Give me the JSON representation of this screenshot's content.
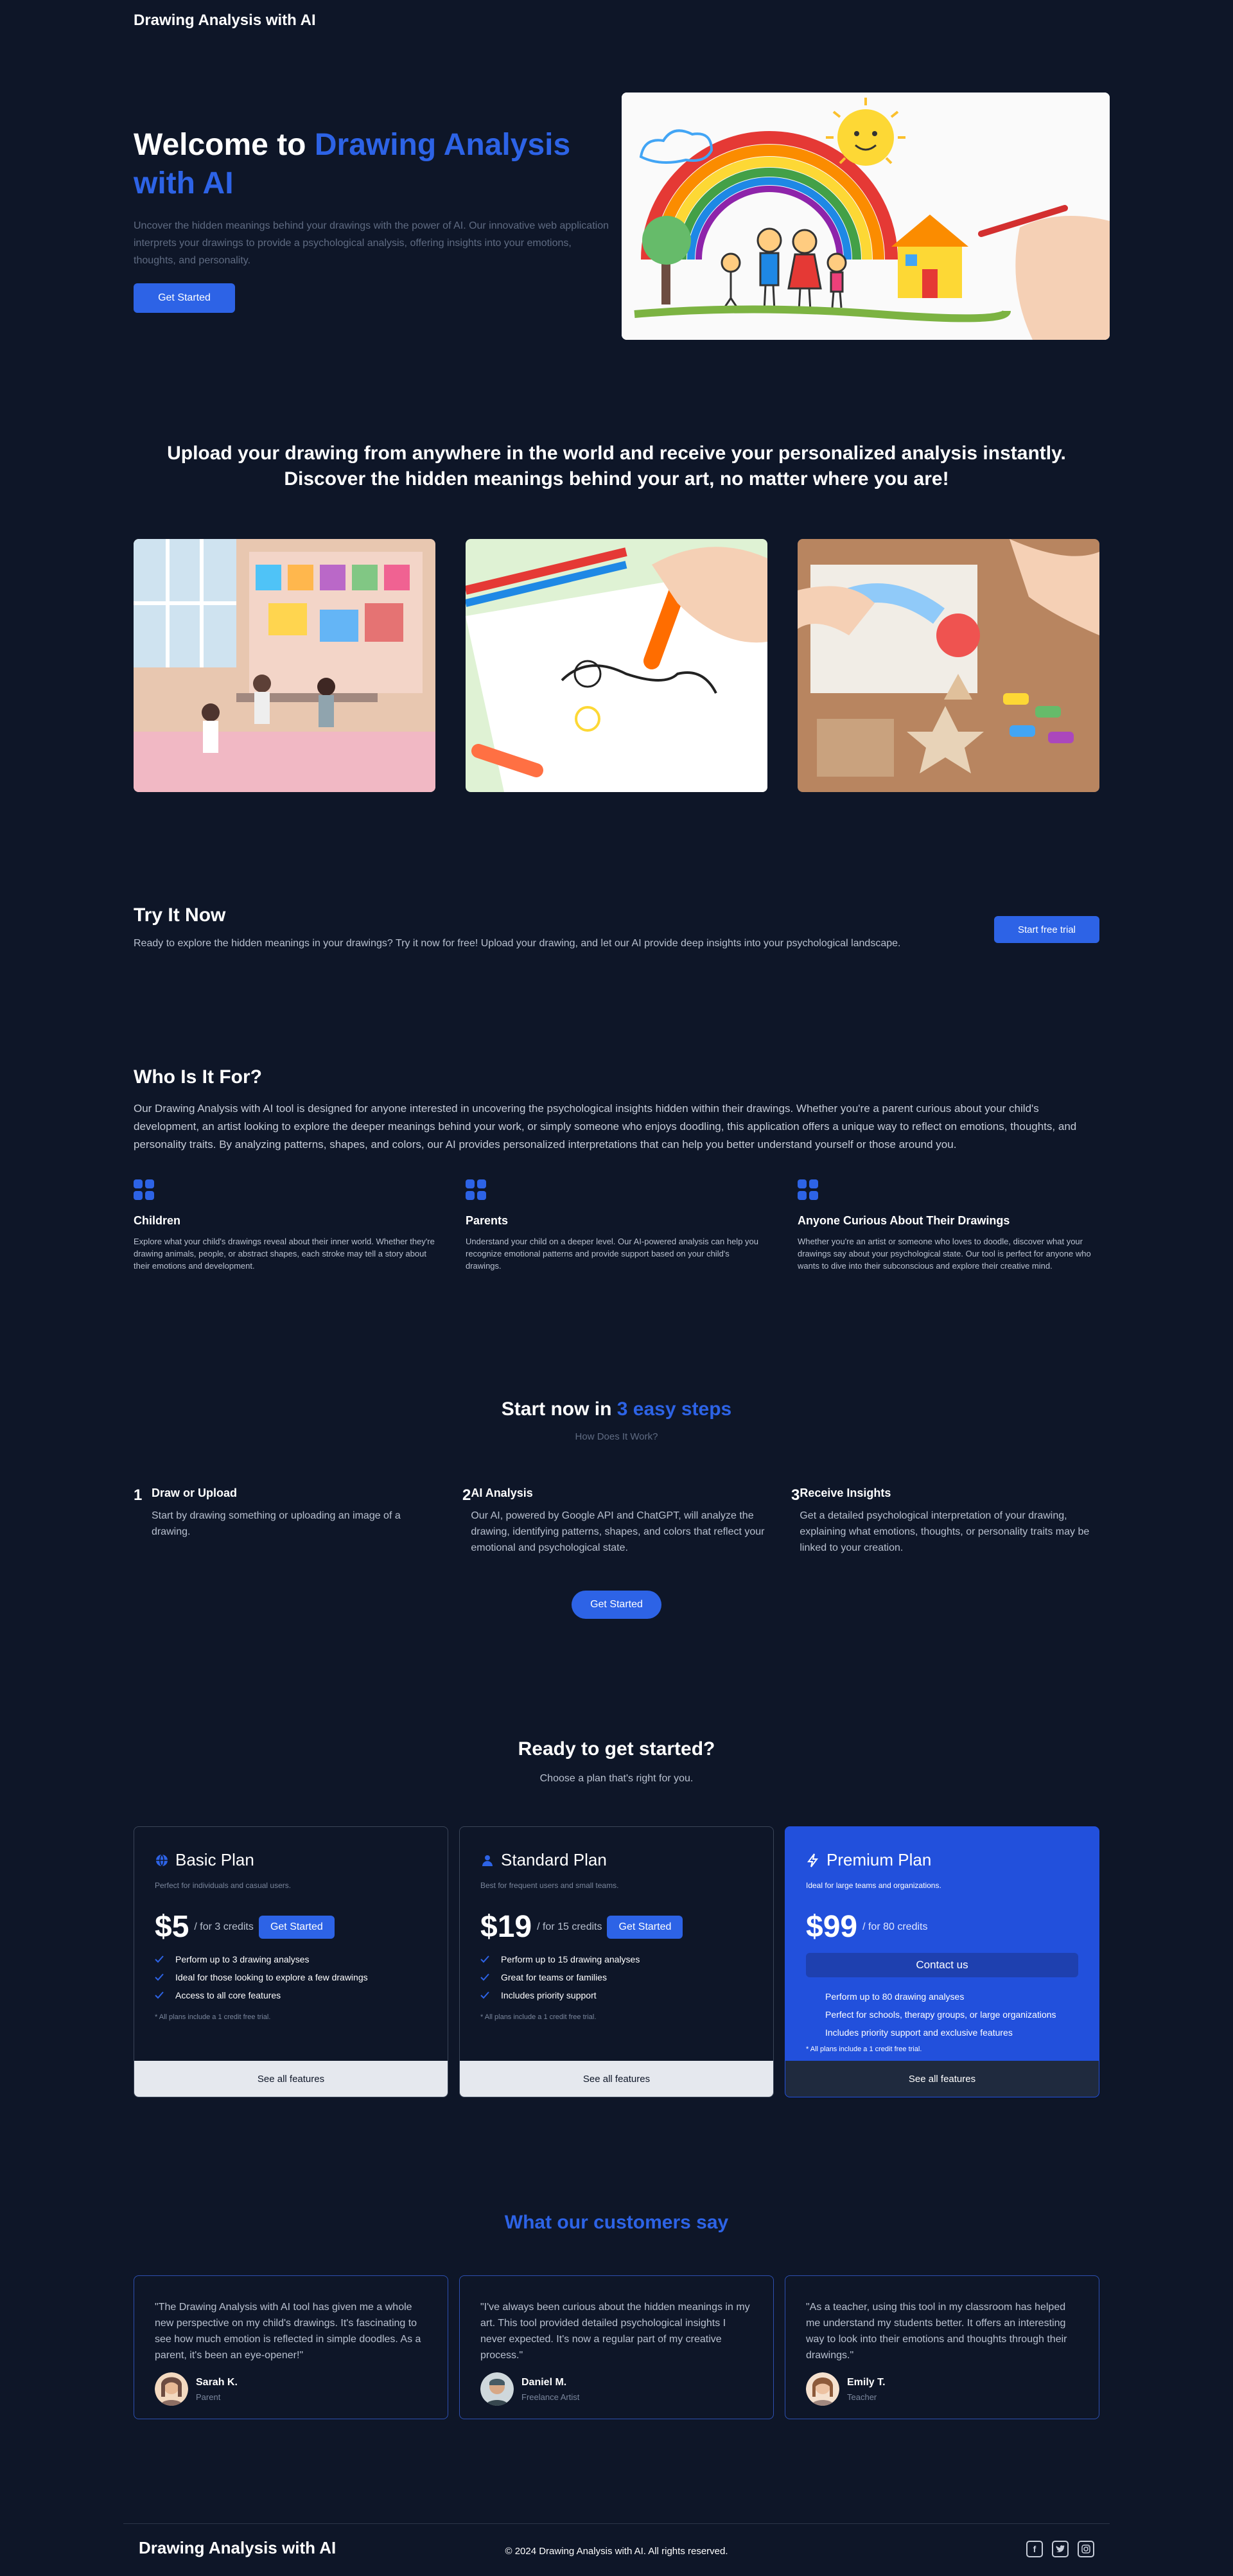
{
  "header": {
    "brand": "Drawing Analysis with AI"
  },
  "hero": {
    "title_prefix": "Welcome to ",
    "title_highlight": "Drawing Analysis with AI",
    "description": "Uncover the hidden meanings behind your drawings with the power of AI. Our innovative web application interprets your drawings to provide a psychological analysis, offering insights into your emotions, thoughts, and personality.",
    "cta_label": "Get Started",
    "image": "child-drawing-rainbow-family-house"
  },
  "upload": {
    "title": "Upload your drawing from anywhere in the world and receive your personalized analysis instantly. Discover the hidden meanings behind your art, no matter where you are!",
    "images": [
      "classroom-children-drawing",
      "child-coloring-marker",
      "hands-crafting-with-crayons"
    ]
  },
  "try_now": {
    "title": "Try It Now",
    "text": "Ready to explore the hidden meanings in your drawings? Try it now for free! Upload your drawing, and let our AI provide deep insights into your psychological landscape.",
    "button": "Start free trial"
  },
  "who": {
    "title": "Who Is It For?",
    "lead": "Our Drawing Analysis with AI tool is designed for anyone interested in uncovering the psychological insights hidden within their drawings. Whether you're a parent curious about your child's development, an artist looking to explore the deeper meanings behind your work, or simply someone who enjoys doodling, this application offers a unique way to reflect on emotions, thoughts, and personality traits. By analyzing patterns, shapes, and colors, our AI provides personalized interpretations that can help you better understand yourself or those around you.",
    "audiences": [
      {
        "title": "Children",
        "text": "Explore what your child's drawings reveal about their inner world. Whether they're drawing animals, people, or abstract shapes, each stroke may tell a story about their emotions and development."
      },
      {
        "title": "Parents",
        "text": "Understand your child on a deeper level. Our AI-powered analysis can help you recognize emotional patterns and provide support based on your child's drawings."
      },
      {
        "title": "Anyone Curious About Their Drawings",
        "text": "Whether you're an artist or someone who loves to doodle, discover what your drawings say about your psychological state. Our tool is perfect for anyone who wants to dive into their subconscious and explore their creative mind."
      }
    ]
  },
  "steps": {
    "title_prefix": "Start now in ",
    "title_highlight": "3 easy steps",
    "subtitle": "How Does It Work?",
    "items": [
      {
        "num": "1",
        "title": "Draw or Upload",
        "text": "Start by drawing something or uploading an image of a drawing."
      },
      {
        "num": "2",
        "title": "AI Analysis",
        "text": "Our AI, powered by Google API and ChatGPT, will analyze the drawing, identifying patterns, shapes, and colors that reflect your emotional and psychological state."
      },
      {
        "num": "3",
        "title": "Receive Insights",
        "text": "Get a detailed psychological interpretation of your drawing, explaining what emotions, thoughts, or personality traits may be linked to your creation."
      }
    ],
    "button": "Get Started"
  },
  "pricing": {
    "title": "Ready to get started?",
    "subtitle": "Choose a plan that's right for you.",
    "plans": [
      {
        "name": "Basic Plan",
        "icon": "globe-icon",
        "desc": "Perfect for individuals and casual users.",
        "price": "$5",
        "credits": "/ for 3 credits",
        "button": "Get Started",
        "features": [
          "Perform up to 3 drawing analyses",
          "Ideal for those looking to explore a few drawings",
          "Access to all core features"
        ],
        "note": "* All plans include a 1 credit free trial.",
        "footer": "See all features"
      },
      {
        "name": "Standard Plan",
        "icon": "user-icon",
        "desc": "Best for frequent users and small teams.",
        "price": "$19",
        "credits": "/ for 15 credits",
        "button": "Get Started",
        "features": [
          "Perform up to 15 drawing analyses",
          "Great for teams or families",
          "Includes priority support"
        ],
        "note": "* All plans include a 1 credit free trial.",
        "footer": "See all features"
      },
      {
        "name": "Premium Plan",
        "icon": "lightning-icon",
        "desc": "Ideal for large teams and organizations.",
        "price": "$99",
        "credits": "/ for 80 credits",
        "button": "Contact us",
        "features": [
          "Perform up to 80 drawing analyses",
          "Perfect for schools, therapy groups, or large organizations",
          "Includes priority support and exclusive features"
        ],
        "note": "* All plans include a 1 credit free trial.",
        "footer": "See all features"
      }
    ]
  },
  "testimonials": {
    "title": "What our customers say",
    "items": [
      {
        "quote": "\"The Drawing Analysis with AI tool has given me a whole new perspective on my child's drawings. It's fascinating to see how much emotion is reflected in simple doodles. As a parent, it's been an eye-opener!\"",
        "name": "Sarah K.",
        "role": "Parent"
      },
      {
        "quote": "\"I've always been curious about the hidden meanings in my art. This tool provided detailed psychological insights I never expected. It's now a regular part of my creative process.\"",
        "name": "Daniel M.",
        "role": "Freelance Artist"
      },
      {
        "quote": "\"As a teacher, using this tool in my classroom has helped me understand my students better. It offers an interesting way to look into their emotions and thoughts through their drawings.\"",
        "name": "Emily T.",
        "role": "Teacher"
      }
    ]
  },
  "footer": {
    "brand": "Drawing Analysis with AI",
    "copyright": "© 2024 Drawing Analysis with AI. All rights reserved.",
    "socials": [
      "facebook-icon",
      "twitter-icon",
      "instagram-icon"
    ]
  },
  "colors": {
    "background": "#0e1628",
    "accent": "#2d63e6",
    "premium": "#2250dc"
  }
}
